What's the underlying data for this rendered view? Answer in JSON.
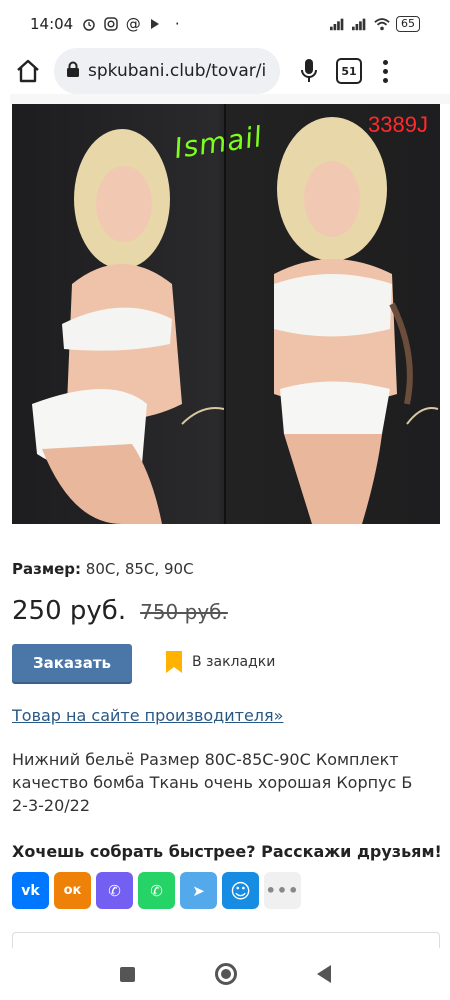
{
  "status_bar": {
    "time": "14:04",
    "battery": "65"
  },
  "browser": {
    "url": "spkubani.club/tovar/i",
    "tab_count": "51"
  },
  "product": {
    "image_labels": {
      "green": "Ismail",
      "red": "3389J"
    },
    "size_label": "Размер:",
    "size_value": "80C, 85C, 90C",
    "price": "250 руб.",
    "old_price": "750 руб.",
    "order_button": "Заказать",
    "bookmark_label": "В закладки",
    "manufacturer_link": "Товар на сайте производителя»",
    "description": "Нижний бельё Размер 80С-85С-90С Комплект качество бомба Ткань очень хорошая Корпус Б 2-3-20/22"
  },
  "share": {
    "title": "Хочешь собрать быстрее? Расскажи друзьям!",
    "networks": [
      {
        "name": "vk",
        "glyph": "vk",
        "color": "#0077ff"
      },
      {
        "name": "odnoklassniki",
        "glyph": "ок",
        "color": "#ee8208"
      },
      {
        "name": "viber",
        "glyph": "✆",
        "color": "#7360f2"
      },
      {
        "name": "whatsapp",
        "glyph": "✆",
        "color": "#25d366"
      },
      {
        "name": "telegram",
        "glyph": "➤",
        "color": "#54a9eb"
      },
      {
        "name": "moimir",
        "glyph": "☺",
        "color": "#168de2"
      },
      {
        "name": "more",
        "glyph": "•••",
        "color": "#f0f0f0"
      }
    ]
  },
  "colors": {
    "accent": "#4a76a8",
    "link": "#2a5885",
    "bookmark": "#ffb300"
  }
}
